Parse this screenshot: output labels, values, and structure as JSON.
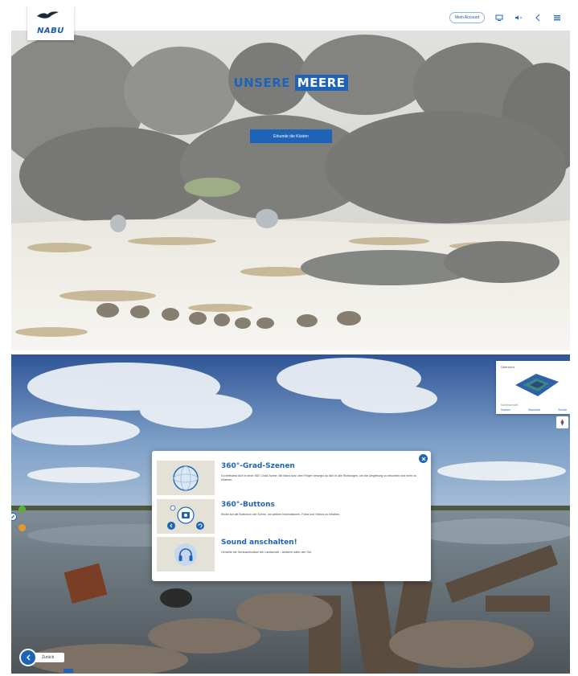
{
  "top_screen": {
    "logo_text": "NABU",
    "header_button": "Mein Account",
    "hero_title_part1": "UNSERE",
    "hero_title_part2": "MEERE",
    "hero_cta": "Erkunde die Küsten",
    "icons": [
      "bird-logo-icon",
      "display-icon",
      "audio-icon",
      "share-icon",
      "menu-icon"
    ]
  },
  "bottom_screen": {
    "minimap": {
      "title": "Übersicht",
      "subtitle": "Kartenansicht",
      "links": [
        "Szenen",
        "Standorte",
        "Zurück"
      ]
    },
    "modal": {
      "rows": [
        {
          "title": "360°-Grad-Szenen",
          "text": "Du befindest dich in einer 360°-Grad-Szene. Mit Maus bzw. dem Finger bewegst du dich in alle Richtungen, um die Umgebung zu erkunden und mehr zu erfahren."
        },
        {
          "title": "360°-Buttons",
          "text": "Klicke auf die Buttons in der Szene, um weitere Informationen, Fotos und Videos zu erhalten."
        },
        {
          "title": "Sound anschalten!",
          "text": "Genieße die Geräuschkulisse der Landschaft – aktiviere dafür den Ton."
        }
      ]
    },
    "back_label": "Zurück",
    "colors": {
      "accent": "#1d64b8",
      "green": "#5cae3c",
      "orange": "#e8962f"
    }
  }
}
